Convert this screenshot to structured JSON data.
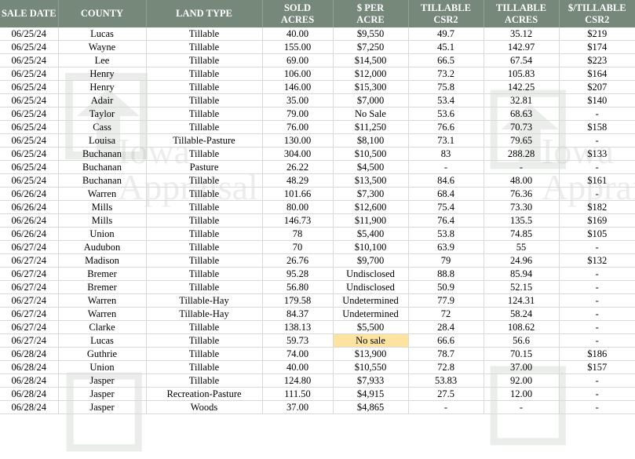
{
  "headers": {
    "sale_date": "SALE DATE",
    "county": "COUNTY",
    "land_type": "LAND TYPE",
    "sold_acres": [
      "SOLD",
      "ACRES"
    ],
    "per_acre": [
      "$ PER",
      "ACRE"
    ],
    "csr2": [
      "TILLABLE",
      "CSR2"
    ],
    "till_acres": [
      "TILLABLE",
      "ACRES"
    ],
    "per_till_csr2": [
      "$/TILLABLE",
      "CSR2"
    ]
  },
  "watermark": {
    "line1": "Iowa",
    "line2": "Appraisal"
  },
  "highlight_color": "#fce4a0",
  "header_color": "#76887a",
  "rows": [
    [
      "06/25/24",
      "Lucas",
      "Tillable",
      "40.00",
      "$9,550",
      "49.7",
      "35.12",
      "$219"
    ],
    [
      "06/25/24",
      "Wayne",
      "Tillable",
      "155.00",
      "$7,250",
      "45.1",
      "142.97",
      "$174"
    ],
    [
      "06/25/24",
      "Lee",
      "Tillable",
      "69.00",
      "$14,500",
      "66.5",
      "67.54",
      "$223"
    ],
    [
      "06/25/24",
      "Henry",
      "Tillable",
      "106.00",
      "$12,000",
      "73.2",
      "105.83",
      "$164"
    ],
    [
      "06/25/24",
      "Henry",
      "Tillable",
      "146.00",
      "$15,300",
      "75.8",
      "142.25",
      "$207"
    ],
    [
      "06/25/24",
      "Adair",
      "Tillable",
      "35.00",
      "$7,000",
      "53.4",
      "32.81",
      "$140"
    ],
    [
      "06/25/24",
      "Taylor",
      "Tillable",
      "79.00",
      "No Sale",
      "53.6",
      "68.63",
      "-"
    ],
    [
      "06/25/24",
      "Cass",
      "Tillable",
      "76.00",
      "$11,250",
      "76.6",
      "70.73",
      "$158"
    ],
    [
      "06/25/24",
      "Louisa",
      "Tillable-Pasture",
      "130.00",
      "$8,100",
      "73.1",
      "79.65",
      "-"
    ],
    [
      "06/25/24",
      "Buchanan",
      "Tillable",
      "304.00",
      "$10,500",
      "83",
      "288.28",
      "$133"
    ],
    [
      "06/25/24",
      "Buchanan",
      "Pasture",
      "26.22",
      "$4,500",
      "-",
      "-",
      "-"
    ],
    [
      "06/25/24",
      "Buchanan",
      "Tillable",
      "48.29",
      "$13,500",
      "84.6",
      "48.00",
      "$161"
    ],
    [
      "06/26/24",
      "Warren",
      "Tillable",
      "101.66",
      "$7,300",
      "68.4",
      "76.36",
      "-"
    ],
    [
      "06/26/24",
      "Mills",
      "Tillable",
      "80.00",
      "$12,600",
      "75.4",
      "73.30",
      "$182"
    ],
    [
      "06/26/24",
      "Mills",
      "Tillable",
      "146.73",
      "$11,900",
      "76.4",
      "135.5",
      "$169"
    ],
    [
      "06/26/24",
      "Union",
      "Tillable",
      "78",
      "$5,400",
      "53.8",
      "74.85",
      "$105"
    ],
    [
      "06/27/24",
      "Audubon",
      "Tillable",
      "70",
      "$10,100",
      "63.9",
      "55",
      "-"
    ],
    [
      "06/27/24",
      "Madison",
      "Tillable",
      "26.76",
      "$9,700",
      "79",
      "24.96",
      "$132"
    ],
    [
      "06/27/24",
      "Bremer",
      "Tillable",
      "95.28",
      "Undisclosed",
      "88.8",
      "85.94",
      "-"
    ],
    [
      "06/27/24",
      "Bremer",
      "Tillable",
      "56.80",
      "Undisclosed",
      "50.9",
      "52.15",
      "-"
    ],
    [
      "06/27/24",
      "Warren",
      "Tillable-Hay",
      "179.58",
      "Undetermined",
      "77.9",
      "124.31",
      "-"
    ],
    [
      "06/27/24",
      "Warren",
      "Tillable-Hay",
      "84.37",
      "Undetermined",
      "72",
      "58.24",
      "-"
    ],
    [
      "06/27/24",
      "Clarke",
      "Tillable",
      "138.13",
      "$5,500",
      "28.4",
      "108.62",
      "-"
    ],
    [
      "06/27/24",
      "Lucas",
      "Tillable",
      "59.73",
      "No sale",
      "66.6",
      "56.6",
      "-"
    ],
    [
      "06/28/24",
      "Guthrie",
      "Tillable",
      "74.00",
      "$13,900",
      "78.7",
      "70.15",
      "$186"
    ],
    [
      "06/28/24",
      "Union",
      "Tillable",
      "40.00",
      "$10,550",
      "72.8",
      "37.00",
      "$157"
    ],
    [
      "06/28/24",
      "Jasper",
      "Tillable",
      "124.80",
      "$7,933",
      "53.83",
      "92.00",
      "-"
    ],
    [
      "06/28/24",
      "Jasper",
      "Recreation-Pasture",
      "111.50",
      "$4,915",
      "27.5",
      "12.00",
      "-"
    ],
    [
      "06/28/24",
      "Jasper",
      "Woods",
      "37.00",
      "$4,865",
      "-",
      "-",
      "-"
    ]
  ],
  "highlighted_cell": {
    "row": 23,
    "col": 4
  }
}
